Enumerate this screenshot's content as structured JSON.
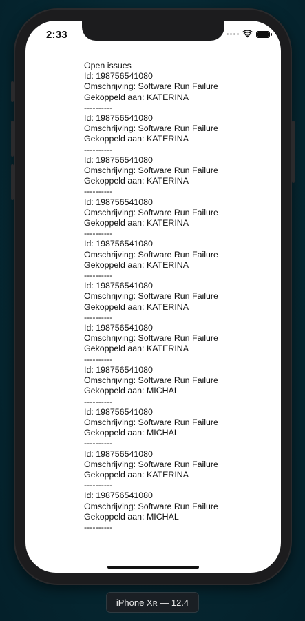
{
  "status_bar": {
    "time": "2:33"
  },
  "issues": {
    "title": "Open issues",
    "id_prefix": "Id: ",
    "desc_prefix": "Omschrijving: ",
    "assign_prefix": "Gekoppeld aan: ",
    "separator": "----------",
    "items": [
      {
        "id": "198756541080",
        "description": "Software Run Failure",
        "assignee": "KATERINA"
      },
      {
        "id": "198756541080",
        "description": "Software Run Failure",
        "assignee": "KATERINA"
      },
      {
        "id": "198756541080",
        "description": "Software Run Failure",
        "assignee": "KATERINA"
      },
      {
        "id": "198756541080",
        "description": "Software Run Failure",
        "assignee": "KATERINA"
      },
      {
        "id": "198756541080",
        "description": "Software Run Failure",
        "assignee": "KATERINA"
      },
      {
        "id": "198756541080",
        "description": "Software Run Failure",
        "assignee": "KATERINA"
      },
      {
        "id": "198756541080",
        "description": "Software Run Failure",
        "assignee": "KATERINA"
      },
      {
        "id": "198756541080",
        "description": "Software Run Failure",
        "assignee": "MICHAL"
      },
      {
        "id": "198756541080",
        "description": "Software Run Failure",
        "assignee": "MICHAL"
      },
      {
        "id": "198756541080",
        "description": "Software Run Failure",
        "assignee": "KATERINA"
      },
      {
        "id": "198756541080",
        "description": "Software Run Failure",
        "assignee": "MICHAL"
      }
    ]
  },
  "device_label": "iPhone Xʀ — 12.4",
  "icons": {
    "signal": "cellular-signal-icon",
    "wifi": "wifi-icon",
    "battery": "battery-icon"
  }
}
